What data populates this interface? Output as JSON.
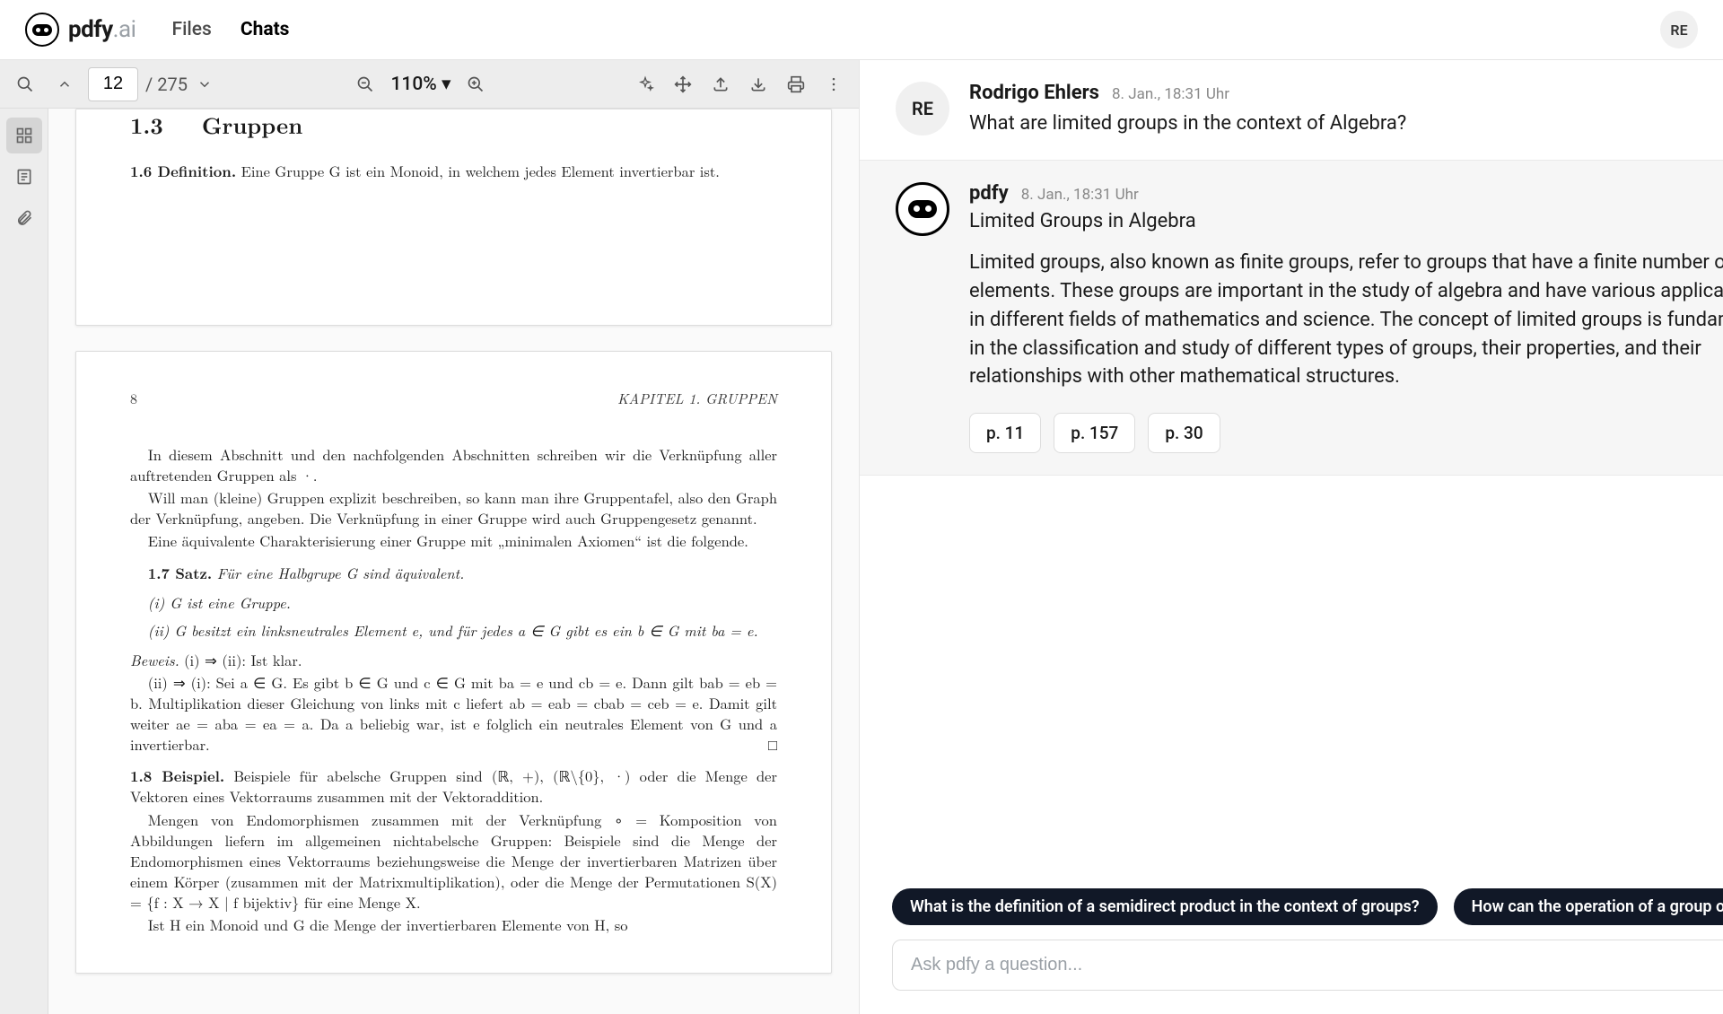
{
  "header": {
    "logo_main": "pdfy",
    "logo_suffix": ".ai",
    "nav": {
      "files": "Files",
      "chats": "Chats"
    },
    "avatar": "RE"
  },
  "toolbar": {
    "page_current": "12",
    "page_total": "/ 275",
    "zoom": "110% ▾"
  },
  "doc": {
    "section_num": "1.3",
    "section_title": "Gruppen",
    "def16_head": "1.6 Definition.",
    "def16_body": "Eine Gruppe G ist ein Monoid, in welchem jedes Element invertierbar ist.",
    "page_num": "8",
    "page_chapter": "KAPITEL 1.  GRUPPEN",
    "p1": "In diesem Abschnitt und den nachfolgenden Abschnitten schreiben wir die Verknüpfung aller auftretenden Gruppen als ·.",
    "p2": "Will man (kleine) Gruppen explizit beschreiben, so kann man ihre Gruppentafel, also den Graph der Verknüpfung, angeben. Die Verknüpfung in einer Gruppe wird auch Gruppengesetz genannt.",
    "p3": "Eine äquivalente Charakterisierung einer Gruppe mit „minimalen Axiomen“ ist die folgende.",
    "satz17_head": "1.7 Satz.",
    "satz17_body": "Für eine Halbgrupe G sind äquivalent.",
    "item_i": "(i) G ist eine Gruppe.",
    "item_ii": "(ii) G besitzt ein linksneutrales Element e, und für jedes a ∈ G gibt es ein b ∈ G mit ba = e.",
    "proof_head": "Beweis.",
    "proof_1": "(i) ⇒ (ii): Ist klar.",
    "proof_2": "(ii) ⇒ (i): Sei a ∈ G. Es gibt b ∈ G und c ∈ G mit ba = e und cb = e. Dann gilt bab = eb = b. Multiplikation dieser Gleichung von links mit c liefert ab = eab = cbab = ceb = e. Damit gilt weiter ae = aba = ea = a. Da a beliebig war, ist e folglich ein neutrales Element von G und a invertierbar.",
    "qed": "□",
    "ex18_head": "1.8 Beispiel.",
    "ex18_1": "Beispiele für abelsche Gruppen sind (ℝ, +), (ℝ\\{0}, ·) oder die Menge der Vektoren eines Vektorraums zusammen mit der Vektoraddition.",
    "ex18_2": "Mengen von Endomorphismen zusammen mit der Verknüpfung ∘ = Komposition von Abbildungen liefern im allgemeinen nichtabelsche Gruppen: Beispiele sind die Menge der Endomorphismen eines Vektorraums beziehungsweise die Menge der invertierbaren Matrizen über einem Körper (zusammen mit der Matrixmultiplikation), oder die Menge der Permutationen S(X) = {f : X → X | f bijektiv} für eine Menge X.",
    "ex18_3": "Ist H ein Monoid und G die Menge der invertierbaren Elemente von H, so"
  },
  "chat": {
    "user": {
      "avatar": "RE",
      "name": "Rodrigo Ehlers",
      "time": "8. Jan., 18:31 Uhr",
      "text": "What are limited groups in the context of Algebra?"
    },
    "bot": {
      "name": "pdfy",
      "time": "8. Jan., 18:31 Uhr",
      "subtitle": "Limited Groups in Algebra",
      "text": "Limited groups, also known as finite groups, refer to groups that have a finite number of elements. These groups are important in the study of algebra and have various applications in different fields of mathematics and science. The concept of limited groups is fundamental in the classification and study of different types of groups, their properties, and their relationships with other mathematical structures.",
      "refs": [
        "p. 11",
        "p. 157",
        "p. 30"
      ]
    }
  },
  "suggestions": [
    "What is the definition of a semidirect product in the context of groups?",
    "How can the operation of a group on a set"
  ],
  "input": {
    "placeholder": "Ask pdfy a question..."
  }
}
